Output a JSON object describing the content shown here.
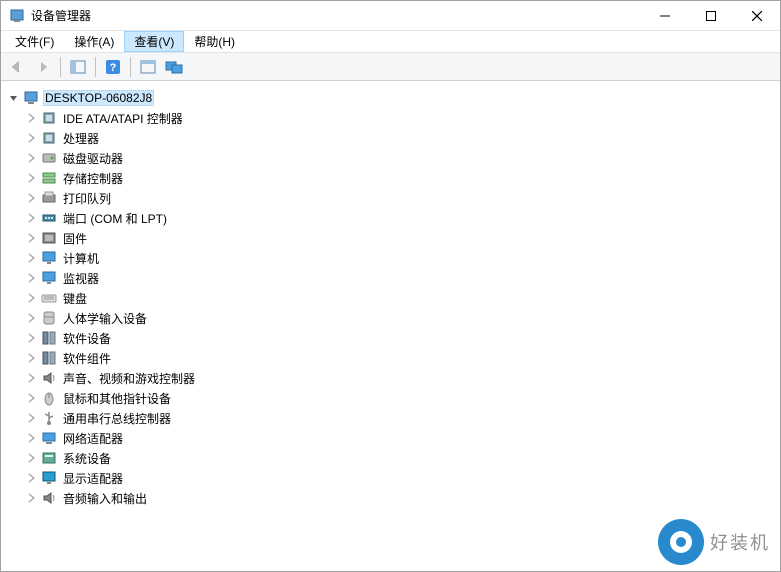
{
  "window": {
    "title": "设备管理器"
  },
  "menus": {
    "file": "文件(F)",
    "action": "操作(A)",
    "view": "查看(V)",
    "help": "帮助(H)"
  },
  "toolbar": {
    "back": "back-icon",
    "forward": "forward-icon",
    "show_hide": "show-hide-tree-icon",
    "help": "help-icon",
    "properties": "properties-icon",
    "monitors": "monitors-icon"
  },
  "tree": {
    "root": "DESKTOP-06082J8",
    "nodes": [
      {
        "id": "ide",
        "label": "IDE ATA/ATAPI 控制器",
        "icon": "chip"
      },
      {
        "id": "cpu",
        "label": "处理器",
        "icon": "chip"
      },
      {
        "id": "disk",
        "label": "磁盘驱动器",
        "icon": "disk"
      },
      {
        "id": "storage",
        "label": "存储控制器",
        "icon": "storage"
      },
      {
        "id": "print",
        "label": "打印队列",
        "icon": "printer"
      },
      {
        "id": "ports",
        "label": "端口 (COM 和 LPT)",
        "icon": "port"
      },
      {
        "id": "firmware",
        "label": "固件",
        "icon": "firmware"
      },
      {
        "id": "computer",
        "label": "计算机",
        "icon": "monitor"
      },
      {
        "id": "monitor",
        "label": "监视器",
        "icon": "monitor"
      },
      {
        "id": "keyboard",
        "label": "键盘",
        "icon": "keyboard"
      },
      {
        "id": "hid",
        "label": "人体学输入设备",
        "icon": "hid"
      },
      {
        "id": "software-devices",
        "label": "软件设备",
        "icon": "software"
      },
      {
        "id": "software-components",
        "label": "软件组件",
        "icon": "software"
      },
      {
        "id": "sound",
        "label": "声音、视频和游戏控制器",
        "icon": "speaker"
      },
      {
        "id": "mouse",
        "label": "鼠标和其他指针设备",
        "icon": "mouse"
      },
      {
        "id": "usb",
        "label": "通用串行总线控制器",
        "icon": "usb"
      },
      {
        "id": "network",
        "label": "网络适配器",
        "icon": "network"
      },
      {
        "id": "system",
        "label": "系统设备",
        "icon": "system"
      },
      {
        "id": "display",
        "label": "显示适配器",
        "icon": "display"
      },
      {
        "id": "audio-io",
        "label": "音频输入和输出",
        "icon": "speaker"
      }
    ]
  },
  "watermark": {
    "text": "好装机"
  }
}
